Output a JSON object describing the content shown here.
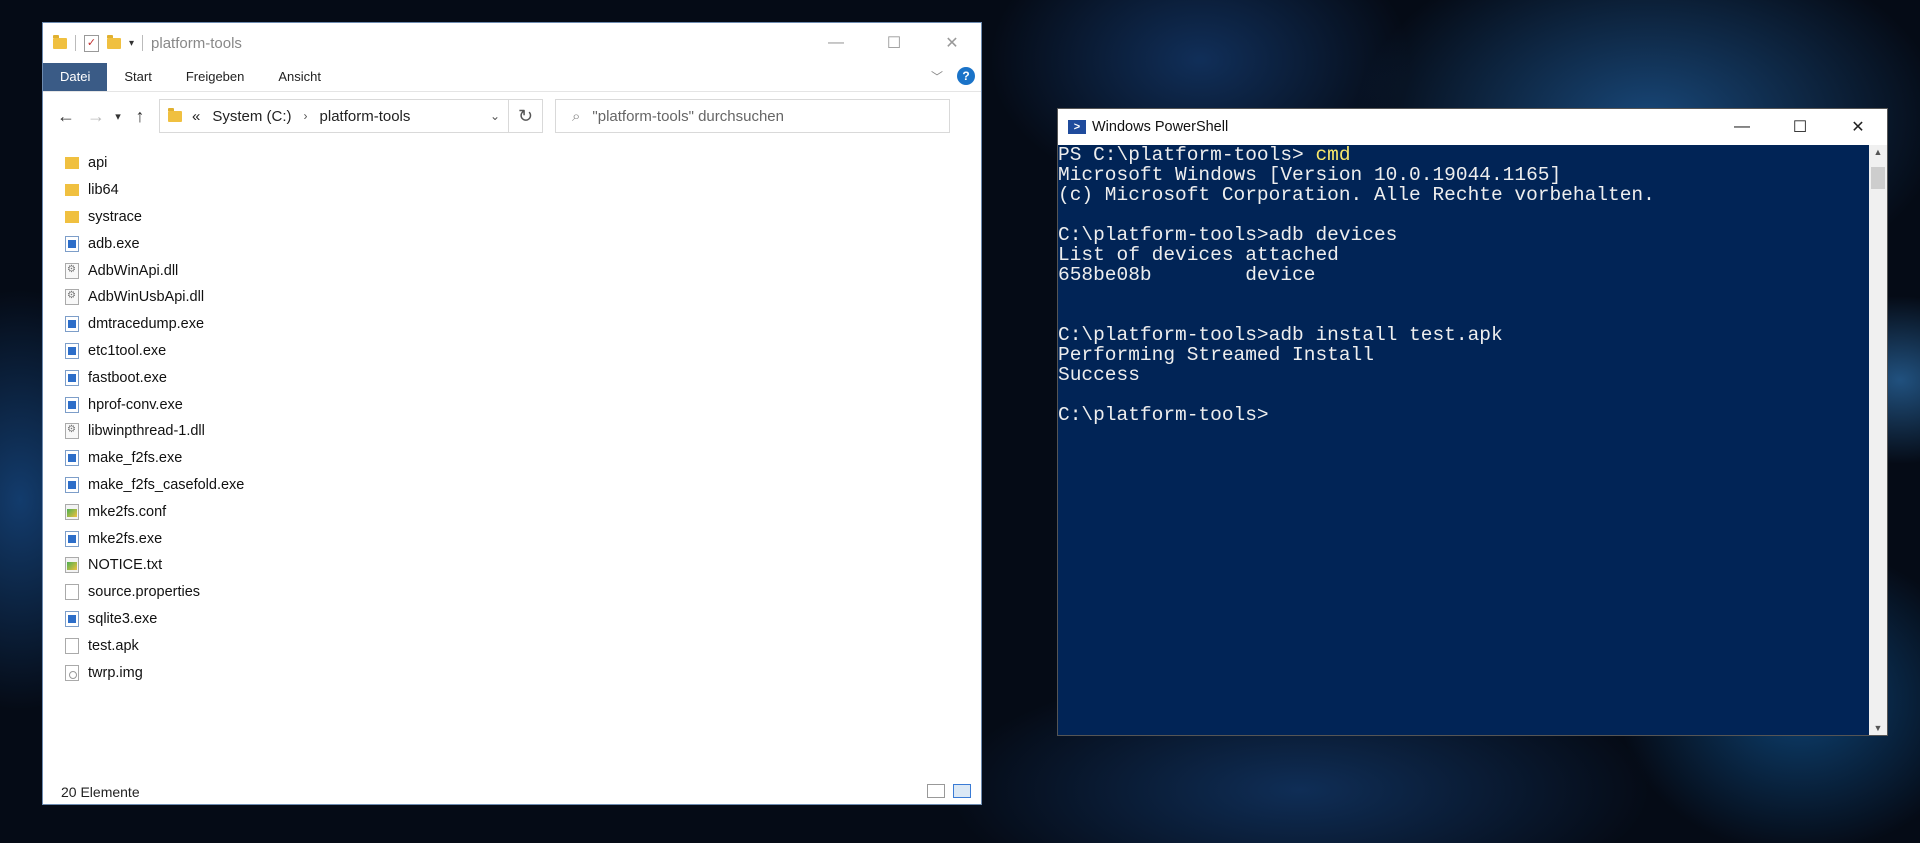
{
  "explorer": {
    "title": "platform-tools",
    "tabs": [
      "Datei",
      "Start",
      "Freigeben",
      "Ansicht"
    ],
    "address": {
      "overflow": "«",
      "crumbs": [
        "System (C:)",
        "platform-tools"
      ]
    },
    "search_placeholder": "\"platform-tools\" durchsuchen",
    "files": [
      {
        "name": "api",
        "type": "folder"
      },
      {
        "name": "lib64",
        "type": "folder"
      },
      {
        "name": "systrace",
        "type": "folder"
      },
      {
        "name": "adb.exe",
        "type": "exe"
      },
      {
        "name": "AdbWinApi.dll",
        "type": "dll"
      },
      {
        "name": "AdbWinUsbApi.dll",
        "type": "dll"
      },
      {
        "name": "dmtracedump.exe",
        "type": "exe"
      },
      {
        "name": "etc1tool.exe",
        "type": "exe"
      },
      {
        "name": "fastboot.exe",
        "type": "exe"
      },
      {
        "name": "hprof-conv.exe",
        "type": "exe"
      },
      {
        "name": "libwinpthread-1.dll",
        "type": "dll"
      },
      {
        "name": "make_f2fs.exe",
        "type": "exe"
      },
      {
        "name": "make_f2fs_casefold.exe",
        "type": "exe"
      },
      {
        "name": "mke2fs.conf",
        "type": "txt"
      },
      {
        "name": "mke2fs.exe",
        "type": "exe"
      },
      {
        "name": "NOTICE.txt",
        "type": "txt"
      },
      {
        "name": "source.properties",
        "type": "blank"
      },
      {
        "name": "sqlite3.exe",
        "type": "exe"
      },
      {
        "name": "test.apk",
        "type": "blank"
      },
      {
        "name": "twrp.img",
        "type": "img"
      }
    ],
    "status": "20 Elemente"
  },
  "powershell": {
    "title": "Windows PowerShell",
    "lines": [
      {
        "text": "PS C:\\platform-tools> ",
        "highlight": "cmd"
      },
      {
        "text": "Microsoft Windows [Version 10.0.19044.1165]"
      },
      {
        "text": "(c) Microsoft Corporation. Alle Rechte vorbehalten."
      },
      {
        "text": ""
      },
      {
        "text": "C:\\platform-tools>adb devices"
      },
      {
        "text": "List of devices attached"
      },
      {
        "text": "658be08b        device"
      },
      {
        "text": ""
      },
      {
        "text": ""
      },
      {
        "text": "C:\\platform-tools>adb install test.apk"
      },
      {
        "text": "Performing Streamed Install"
      },
      {
        "text": "Success"
      },
      {
        "text": ""
      },
      {
        "text": "C:\\platform-tools>"
      }
    ]
  }
}
